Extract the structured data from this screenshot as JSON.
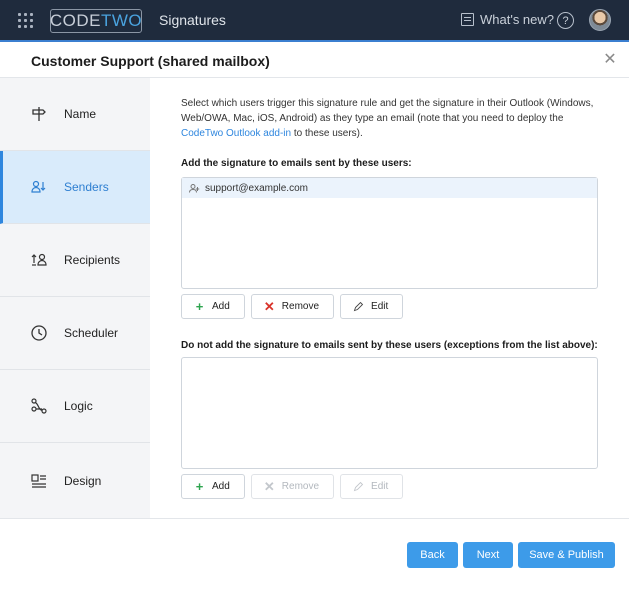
{
  "topbar": {
    "logo_code": "CODE",
    "logo_two": "TWO",
    "app_title": "Signatures",
    "whats_new": "What's new?",
    "help_glyph": "?"
  },
  "dialog": {
    "title": "Customer Support (shared mailbox)",
    "close_glyph": "✕"
  },
  "sidebar": {
    "items": [
      {
        "label": "Name",
        "icon": "signpost-icon",
        "active": false
      },
      {
        "label": "Senders",
        "icon": "senders-icon",
        "active": true
      },
      {
        "label": "Recipients",
        "icon": "recipients-icon",
        "active": false
      },
      {
        "label": "Scheduler",
        "icon": "clock-icon",
        "active": false
      },
      {
        "label": "Logic",
        "icon": "logic-icon",
        "active": false
      },
      {
        "label": "Design",
        "icon": "design-icon",
        "active": false
      }
    ]
  },
  "main": {
    "description_pre": "Select which users trigger this signature rule and get the signature in their Outlook (Windows, Web/OWA, Mac, iOS, Android) as they type an email (note that you need to deploy the ",
    "description_link": "CodeTwo Outlook add-in",
    "description_post": " to these users).",
    "include_heading": "Add the signature to emails sent by these users:",
    "include_list": [
      "support@example.com"
    ],
    "include_buttons": {
      "add": "Add",
      "remove": "Remove",
      "edit": "Edit"
    },
    "exclude_heading": "Do not add the signature to emails sent by these users (exceptions from the list above):",
    "exclude_list": [],
    "exclude_buttons": {
      "add": "Add",
      "remove": "Remove",
      "edit": "Edit"
    }
  },
  "footer": {
    "back": "Back",
    "next": "Next",
    "save_publish": "Save & Publish"
  },
  "colors": {
    "topbar_bg": "#1f2b3d",
    "accent": "#2e86de",
    "primary_button": "#3d9be9",
    "active_nav_bg": "#d9ebfb",
    "add_green": "#2ea44f",
    "remove_red": "#d9342b"
  }
}
